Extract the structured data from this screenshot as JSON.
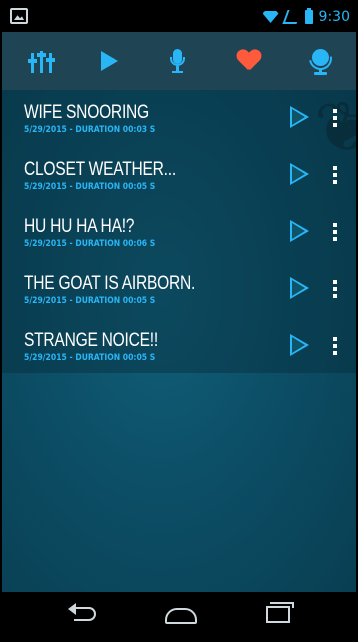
{
  "status_bar": {
    "time": "9:30",
    "left_icon": "image-icon",
    "right_icons": [
      "wifi-icon",
      "signal-icon",
      "battery-icon"
    ]
  },
  "toolbar": {
    "icons": [
      "equalizer-sliders-icon",
      "play-icon",
      "microphone-icon",
      "heart-icon",
      "globe-icon"
    ],
    "accent_color": "#29b6f6",
    "heart_color": "#ff5a3c"
  },
  "recordings": [
    {
      "title": "WIFE SNOORING",
      "meta": "5/29/2015 - DURATION 00:03 S"
    },
    {
      "title": "CLOSET WEATHER...",
      "meta": "5/29/2015 - DURATION 00:05 S"
    },
    {
      "title": "HU HU HA HA!?",
      "meta": "5/29/2015 - DURATION 00:06 S"
    },
    {
      "title": "THE GOAT IS AIRBORN.",
      "meta": "5/29/2015 - DURATION 00:05 S"
    },
    {
      "title": "STRANGE NOICE!!",
      "meta": "5/29/2015 - DURATION 00:05 S"
    }
  ],
  "nav_bar": {
    "icons": [
      "back-icon",
      "home-icon",
      "recent-apps-icon"
    ]
  }
}
